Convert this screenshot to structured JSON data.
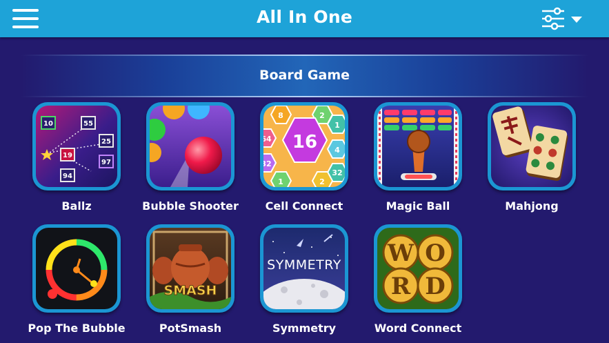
{
  "header": {
    "title": "All In One",
    "menu_icon": "hamburger-menu-icon",
    "filter_icon": "sliders-icon",
    "dropdown_icon": "caret-down-icon",
    "background_color": "#1ea3d8"
  },
  "section": {
    "title": "Board Game"
  },
  "games": [
    {
      "label": "Ballz",
      "icon": "ballz-icon",
      "numbers": [
        "10",
        "55",
        "25",
        "19",
        "97",
        "94"
      ]
    },
    {
      "label": "Bubble Shooter",
      "icon": "bubble-shooter-icon"
    },
    {
      "label": "Cell Connect",
      "icon": "cell-connect-icon",
      "numbers": [
        "16",
        "8",
        "2",
        "1",
        "4",
        "32",
        "64",
        "1",
        "2",
        "32"
      ]
    },
    {
      "label": "Magic Ball",
      "icon": "magic-ball-icon"
    },
    {
      "label": "Mahjong",
      "icon": "mahjong-icon"
    },
    {
      "label": "Pop The Bubble",
      "icon": "pop-the-bubble-icon"
    },
    {
      "label": "PotSmash",
      "icon": "potsmash-icon",
      "logo_text": "SMASH"
    },
    {
      "label": "Symmetry",
      "icon": "symmetry-icon",
      "logo_text": "SYMMETRY"
    },
    {
      "label": "Word Connect",
      "icon": "word-connect-icon",
      "letters": [
        "W",
        "O",
        "R",
        "D"
      ]
    }
  ],
  "colors": {
    "page_background": "#231a6e",
    "icon_frame": "#1b96d3"
  }
}
